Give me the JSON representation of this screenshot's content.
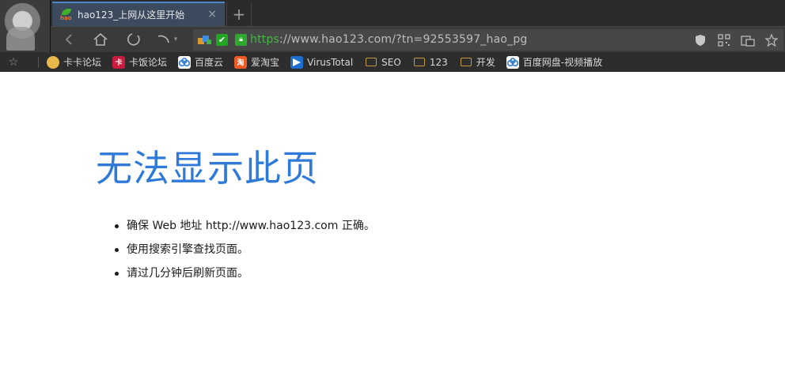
{
  "tab": {
    "title": "hao123_上网从这里开始",
    "close_glyph": "×",
    "favicon_text": "hao"
  },
  "newtab": {
    "glyph": "+"
  },
  "toolbar": {
    "url_scheme": "https",
    "url_rest": "://www.hao123.com/?tn=92553597_hao_pg"
  },
  "bookmarks": [
    {
      "label": "卡卡论坛",
      "icon": "kaka-icon",
      "color": "#e9b84a"
    },
    {
      "label": "卡饭论坛",
      "icon": "kafan-icon",
      "color": "#c81d3e"
    },
    {
      "label": "百度云",
      "icon": "baiduyun-icon",
      "color": "#2f7ad8"
    },
    {
      "label": "爱淘宝",
      "icon": "aitaobao-icon",
      "color": "#f15a24"
    },
    {
      "label": "VirusTotal",
      "icon": "virustotal-icon",
      "color": "#1c6fd1"
    },
    {
      "label": "SEO",
      "icon": "folder-icon"
    },
    {
      "label": "123",
      "icon": "folder-icon"
    },
    {
      "label": "开发",
      "icon": "folder-icon"
    },
    {
      "label": "百度网盘-视频播放",
      "icon": "baiduyun-icon",
      "color": "#2f7ad8"
    }
  ],
  "page": {
    "title": "无法显示此页",
    "items": [
      "确保 Web 地址 http://www.hao123.com 正确。",
      "使用搜索引擎查找页面。",
      "请过几分钟后刷新页面。"
    ]
  }
}
